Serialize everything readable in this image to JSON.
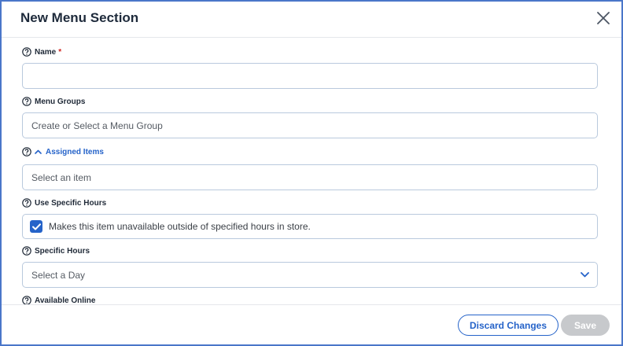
{
  "dialog": {
    "title": "New Menu Section",
    "close_icon": "close-icon"
  },
  "fields": {
    "name": {
      "label": "Name",
      "required_mark": "*",
      "value": "",
      "placeholder": ""
    },
    "menu_groups": {
      "label": "Menu Groups",
      "value": "",
      "placeholder": "Create or Select a Menu Group"
    },
    "assigned_items": {
      "label": "Assigned Items",
      "expanded": true,
      "value": "",
      "placeholder": "Select an item"
    },
    "use_specific_hours": {
      "label": "Use Specific Hours",
      "checkbox_label": "Makes this item unavailable outside of specified hours in store.",
      "checked": true
    },
    "specific_hours": {
      "label": "Specific Hours",
      "selected": "Select a Day"
    },
    "available_online": {
      "label": "Available Online"
    }
  },
  "footer": {
    "discard_label": "Discard Changes",
    "save_label": "Save",
    "save_disabled": true
  },
  "colors": {
    "accent": "#2563c9",
    "border": "#4a76c9",
    "required": "#d0241f",
    "disabled": "#c7c9cc"
  }
}
